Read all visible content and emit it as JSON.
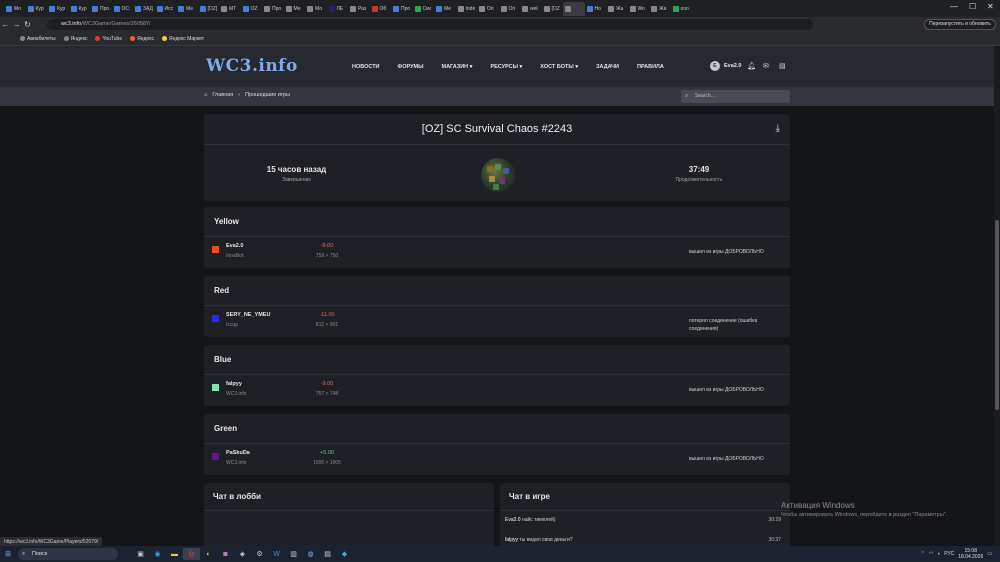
{
  "browser": {
    "tabs": [
      {
        "label": "Мо",
        "color": "#4a7bd6"
      },
      {
        "label": "Кур",
        "color": "#4a7bd6"
      },
      {
        "label": "Кур",
        "color": "#4a7bd6"
      },
      {
        "label": "Кур",
        "color": "#4a7bd6"
      },
      {
        "label": "Про",
        "color": "#4a7bd6"
      },
      {
        "label": "ОС:",
        "color": "#4a7bd6"
      },
      {
        "label": "ЗАД",
        "color": "#4a7bd6"
      },
      {
        "label": "Исс",
        "color": "#4a7bd6"
      },
      {
        "label": "Ме",
        "color": "#4a7bd6"
      },
      {
        "label": "[OZ]",
        "color": "#4a7bd6"
      },
      {
        "label": "MT",
        "color": "#888888"
      },
      {
        "label": "OZ",
        "color": "#4a7bd6"
      },
      {
        "label": "Про",
        "color": "#888888"
      },
      {
        "label": "Ме",
        "color": "#888888"
      },
      {
        "label": "Мо",
        "color": "#888888"
      },
      {
        "label": "ЛЕ",
        "color": "#222266"
      },
      {
        "label": "Раз",
        "color": "#888888"
      },
      {
        "label": "Об",
        "color": "#cc3333"
      },
      {
        "label": "Про",
        "color": "#4a7bd6"
      },
      {
        "label": "Ски",
        "color": "#22aa55"
      },
      {
        "label": "Ме",
        "color": "#4a7bd6"
      },
      {
        "label": "Inde",
        "color": "#888888"
      },
      {
        "label": "Ori",
        "color": "#888888"
      },
      {
        "label": "Ori",
        "color": "#888888"
      },
      {
        "label": "wel",
        "color": "#888888"
      },
      {
        "label": "[OZ",
        "color": "#888888"
      },
      {
        "label": "",
        "color": "#888888",
        "active": true
      },
      {
        "label": "Ho",
        "color": "#4a7bd6"
      },
      {
        "label": "Жа",
        "color": "#888888"
      },
      {
        "label": "Wo",
        "color": "#888888"
      },
      {
        "label": "Жа",
        "color": "#888888"
      },
      {
        "label": "ооо",
        "color": "#22aa55"
      }
    ],
    "url_domain": "wc3.info",
    "url_path": "/WC3Game/Games/260587/",
    "update_button": "Перезапустить и обновить",
    "bookmarks": [
      "Авиабилеты",
      "Яндекс",
      "YouTube",
      "Яндекс",
      "Яндекс Маркет"
    ],
    "status_url": "https://wc3.info/WC3Game/Players/52079/"
  },
  "site": {
    "logo": "WC3.info",
    "nav": [
      "НОВОСТИ",
      "ФОРУМЫ",
      "МАГАЗИН ▾",
      "РЕСУРСЫ ▾",
      "ХОСТ БОТЫ ▾",
      "ЗАДАЧИ",
      "ПРАВИЛА"
    ],
    "user": {
      "initial": "E",
      "name": "Eva2.0"
    },
    "breadcrumbs": [
      "Главная",
      "›",
      "Прошедшие игры"
    ],
    "search_placeholder": "Search..."
  },
  "game": {
    "title": "[OZ] SC Survival Chaos #2243",
    "ended_value": "15 часов назад",
    "ended_label": "Завершение",
    "duration_value": "37:49",
    "duration_label": "Продолжительность"
  },
  "teams": [
    {
      "name": "Yellow",
      "player": "Eva2.0",
      "color": "#e8501e",
      "bot": "IrinaBot",
      "delta": "-9.00",
      "sign": "neg",
      "rating": "759 > 750",
      "reason": "вышел из игры ДОБРОВОЛЬНО"
    },
    {
      "name": "Red",
      "player": "SERY_NE_YMEU",
      "color": "#2a2ae6",
      "bot": "Iccup",
      "delta": "-11.00",
      "sign": "neg",
      "rating": "812 > 801",
      "reason": "потерял соединение (ошибка соединения)"
    },
    {
      "name": "Blue",
      "player": "falpyy",
      "color": "#7fe3b3",
      "bot": "WC3.info",
      "delta": "-9.00",
      "sign": "neg",
      "rating": "757 > 748",
      "reason": "вышел из игры ДОБРОВОЛЬНО"
    },
    {
      "name": "Green",
      "player": "PaSkuDa",
      "color": "#5a1a8a",
      "bot": "WC3.info",
      "delta": "+5.00",
      "sign": "pos",
      "rating": "1000 > 1005",
      "reason": "вышел из игры ДОБРОВОЛЬНО"
    }
  ],
  "lobby_chat": {
    "title": "Чат в лобби"
  },
  "game_chat": {
    "title": "Чат в игре",
    "messages": [
      {
        "author": "Eva2.0",
        "text": "найс тимплей)",
        "time": "30:29"
      },
      {
        "author": "falpyy",
        "text": "ты видел свои деньги?",
        "time": "30:37"
      }
    ]
  },
  "windows_watermark": {
    "title": "Активация Windows",
    "text": "Чтобы активировать Windows, перейдите в раздел \"Параметры\"."
  },
  "taskbar": {
    "search": "Поиск",
    "lang": "РУС",
    "time": "15:08",
    "date": "18.04.2026"
  }
}
